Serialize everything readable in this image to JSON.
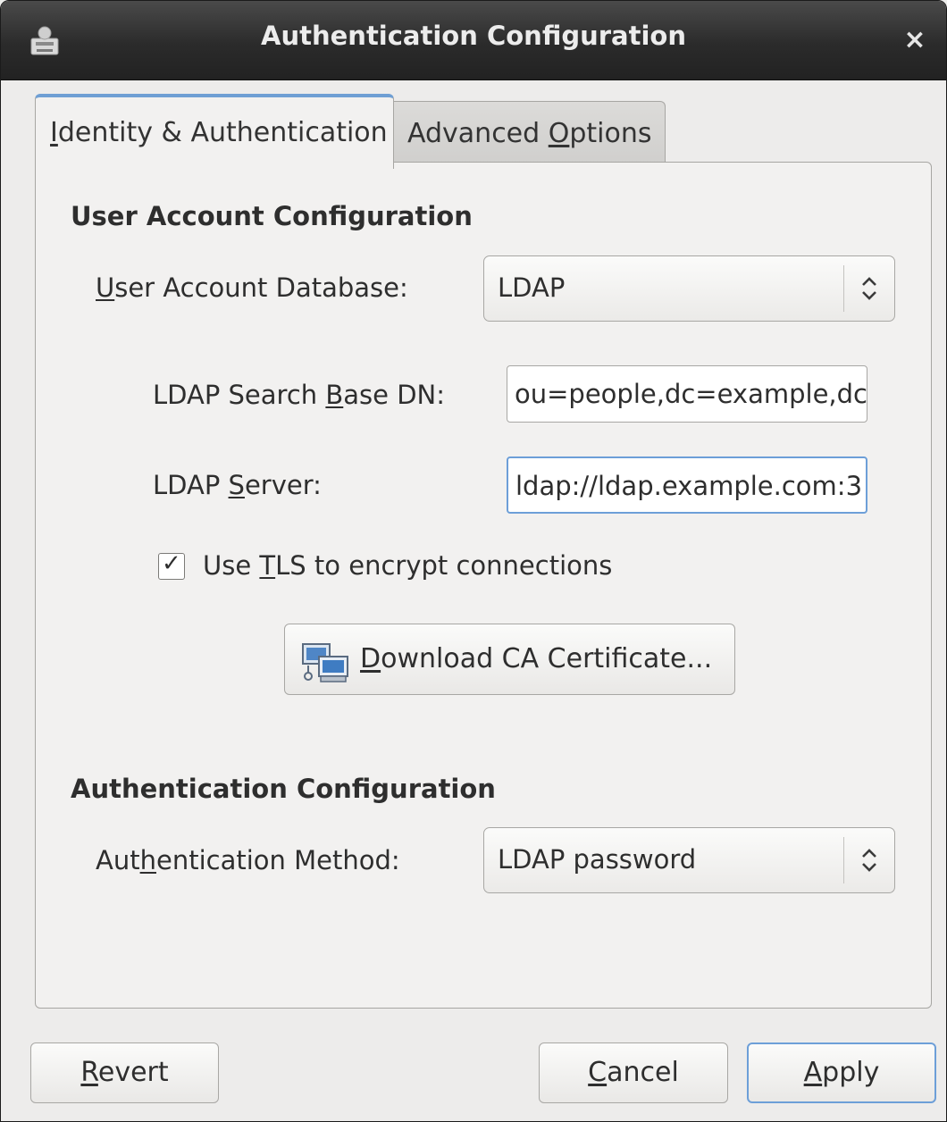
{
  "window": {
    "title": "Authentication Configuration",
    "close_glyph": "×",
    "icon": "app-icon"
  },
  "tabs": [
    {
      "label_pre": "",
      "mnemonic": "I",
      "label_post": "dentity & Authentication",
      "active": true
    },
    {
      "label_pre": "Advanced ",
      "mnemonic": "O",
      "label_post": "ptions",
      "active": false
    }
  ],
  "user_account": {
    "heading": "User Account Configuration",
    "database": {
      "label_pre": "",
      "mnemonic": "U",
      "label_post": "ser Account Database:",
      "value": "LDAP"
    },
    "search_base": {
      "label_pre": "LDAP Search ",
      "mnemonic": "B",
      "label_post": "ase DN:",
      "value": "ou=people,dc=example,dc"
    },
    "server": {
      "label_pre": "LDAP ",
      "mnemonic": "S",
      "label_post": "erver:",
      "value": "ldap://ldap.example.com:3"
    },
    "tls": {
      "label_pre": "Use ",
      "mnemonic": "T",
      "label_post": "LS to encrypt connections",
      "checked": true,
      "check_glyph": "✓"
    },
    "download_button": {
      "label_pre": "",
      "mnemonic": "D",
      "label_post": "ownload CA Certificate..."
    }
  },
  "authentication": {
    "heading": "Authentication Configuration",
    "method": {
      "label_pre": "Aut",
      "mnemonic": "h",
      "label_post": "entication Method:",
      "value": "LDAP password"
    }
  },
  "footer": {
    "revert": {
      "label_pre": "",
      "mnemonic": "R",
      "label_post": "evert"
    },
    "cancel": {
      "label_pre": "",
      "mnemonic": "C",
      "label_post": "ancel"
    },
    "apply": {
      "label_pre": "",
      "mnemonic": "A",
      "label_post": "pply"
    }
  },
  "colors": {
    "titlebar": "#2b2b2b",
    "focus_ring": "#6d9fd8",
    "panel_bg": "#f2f1f0"
  }
}
